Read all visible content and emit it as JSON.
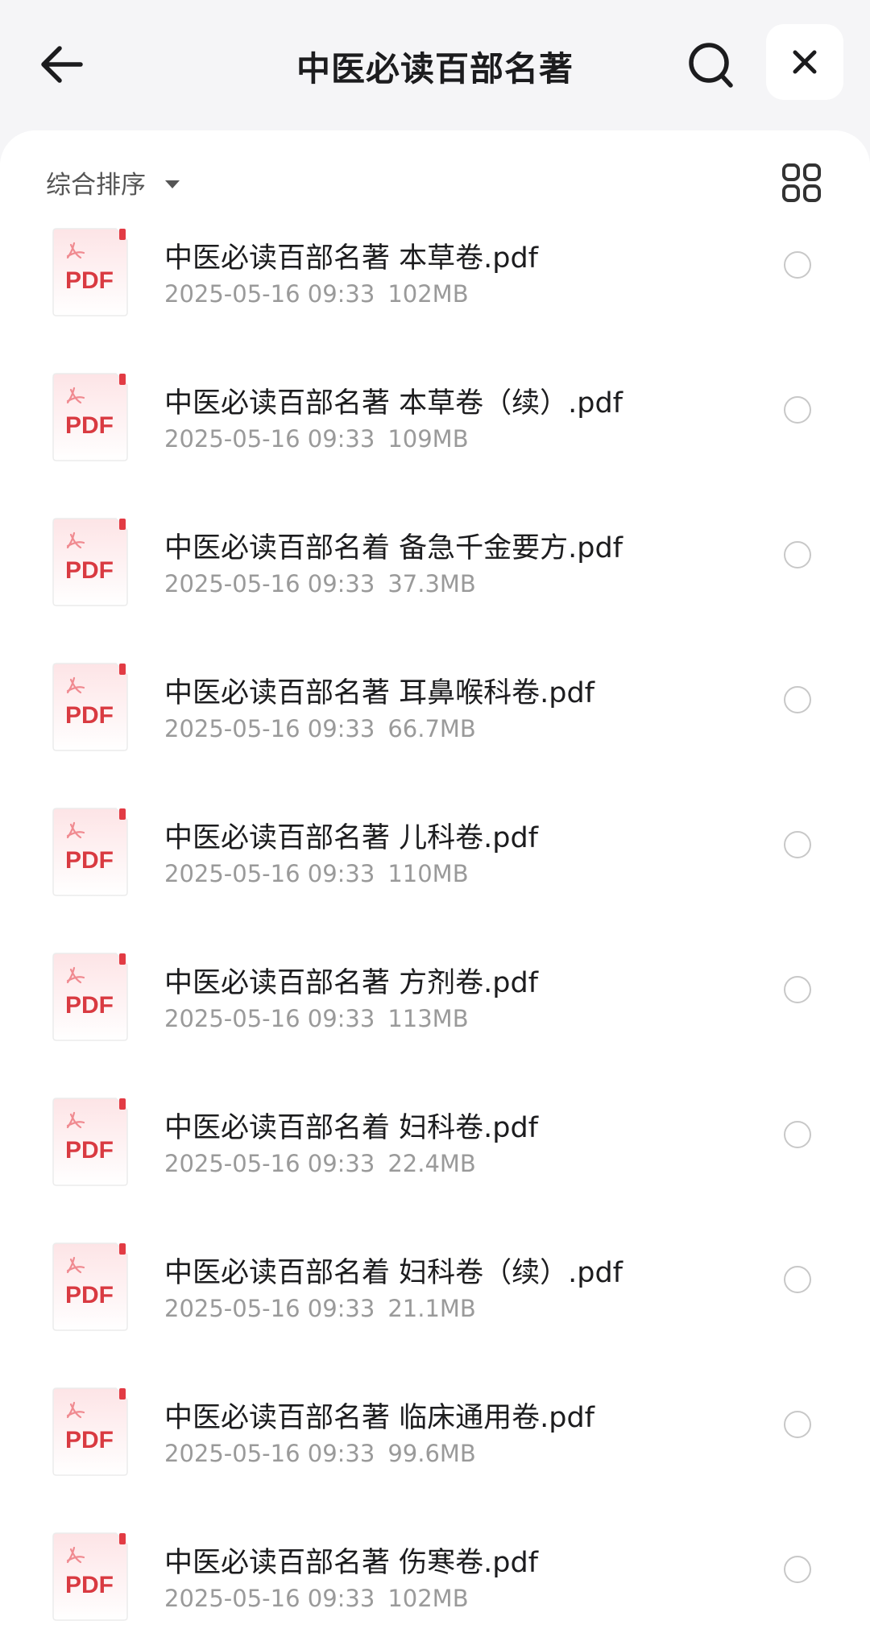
{
  "header": {
    "title": "中医必读百部名著",
    "back_icon": "arrow-left-icon",
    "search_icon": "search-icon",
    "close_icon": "close-icon"
  },
  "toolbar": {
    "sort_label": "综合排序",
    "grid_icon": "grid-view-icon"
  },
  "file_icon_label": "PDF",
  "files": [
    {
      "name": "中医必读百部名著 本草卷.pdf",
      "date": "2025-05-16 09:33",
      "size": "102MB"
    },
    {
      "name": "中医必读百部名著 本草卷（续）.pdf",
      "date": "2025-05-16 09:33",
      "size": "109MB"
    },
    {
      "name": "中医必读百部名着 备急千金要方.pdf",
      "date": "2025-05-16 09:33",
      "size": "37.3MB"
    },
    {
      "name": "中医必读百部名著 耳鼻喉科卷.pdf",
      "date": "2025-05-16 09:33",
      "size": "66.7MB"
    },
    {
      "name": "中医必读百部名著 儿科卷.pdf",
      "date": "2025-05-16 09:33",
      "size": "110MB"
    },
    {
      "name": "中医必读百部名著 方剂卷.pdf",
      "date": "2025-05-16 09:33",
      "size": "113MB"
    },
    {
      "name": "中医必读百部名着 妇科卷.pdf",
      "date": "2025-05-16 09:33",
      "size": "22.4MB"
    },
    {
      "name": "中医必读百部名着 妇科卷（续）.pdf",
      "date": "2025-05-16 09:33",
      "size": "21.1MB"
    },
    {
      "name": "中医必读百部名著 临床通用卷.pdf",
      "date": "2025-05-16 09:33",
      "size": "99.6MB"
    },
    {
      "name": "中医必读百部名著 伤寒卷.pdf",
      "date": "2025-05-16 09:33",
      "size": "102MB"
    }
  ]
}
